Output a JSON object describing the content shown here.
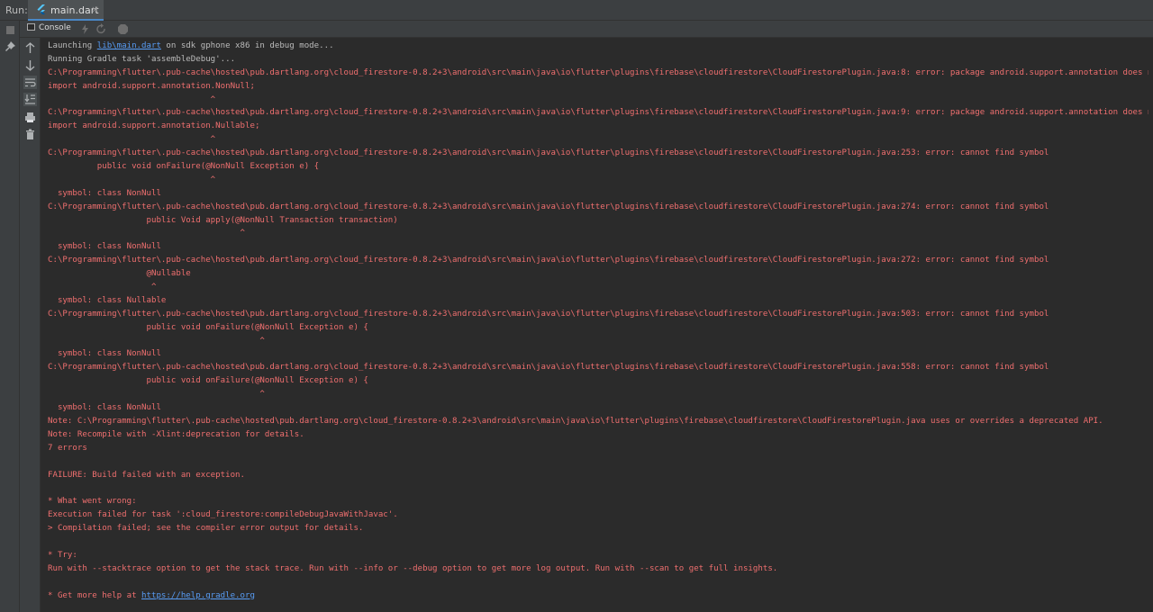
{
  "run_bar": {
    "label": "Run:",
    "tab_name": "main.dart",
    "tab_close": "×"
  },
  "toolbar": {
    "console_label": "Console"
  },
  "console": {
    "launch_prefix": "Launching ",
    "launch_link": "lib\\main.dart",
    "launch_suffix": " on sdk gphone x86 in debug mode...",
    "running_gradle": "Running Gradle task 'assembleDebug'...",
    "lines": [
      "C:\\Programming\\flutter\\.pub-cache\\hosted\\pub.dartlang.org\\cloud_firestore-0.8.2+3\\android\\src\\main\\java\\io\\flutter\\plugins\\firebase\\cloudfirestore\\CloudFirestorePlugin.java:8: error: package android.support.annotation does not exist",
      "import android.support.annotation.NonNull;",
      "                                 ^",
      "C:\\Programming\\flutter\\.pub-cache\\hosted\\pub.dartlang.org\\cloud_firestore-0.8.2+3\\android\\src\\main\\java\\io\\flutter\\plugins\\firebase\\cloudfirestore\\CloudFirestorePlugin.java:9: error: package android.support.annotation does not exist",
      "import android.support.annotation.Nullable;",
      "                                 ^",
      "C:\\Programming\\flutter\\.pub-cache\\hosted\\pub.dartlang.org\\cloud_firestore-0.8.2+3\\android\\src\\main\\java\\io\\flutter\\plugins\\firebase\\cloudfirestore\\CloudFirestorePlugin.java:253: error: cannot find symbol",
      "          public void onFailure(@NonNull Exception e) {",
      "                                 ^",
      "  symbol: class NonNull",
      "C:\\Programming\\flutter\\.pub-cache\\hosted\\pub.dartlang.org\\cloud_firestore-0.8.2+3\\android\\src\\main\\java\\io\\flutter\\plugins\\firebase\\cloudfirestore\\CloudFirestorePlugin.java:274: error: cannot find symbol",
      "                    public Void apply(@NonNull Transaction transaction)",
      "                                       ^",
      "  symbol: class NonNull",
      "C:\\Programming\\flutter\\.pub-cache\\hosted\\pub.dartlang.org\\cloud_firestore-0.8.2+3\\android\\src\\main\\java\\io\\flutter\\plugins\\firebase\\cloudfirestore\\CloudFirestorePlugin.java:272: error: cannot find symbol",
      "                    @Nullable",
      "                     ^",
      "  symbol: class Nullable",
      "C:\\Programming\\flutter\\.pub-cache\\hosted\\pub.dartlang.org\\cloud_firestore-0.8.2+3\\android\\src\\main\\java\\io\\flutter\\plugins\\firebase\\cloudfirestore\\CloudFirestorePlugin.java:503: error: cannot find symbol",
      "                    public void onFailure(@NonNull Exception e) {",
      "                                           ^",
      "  symbol: class NonNull",
      "C:\\Programming\\flutter\\.pub-cache\\hosted\\pub.dartlang.org\\cloud_firestore-0.8.2+3\\android\\src\\main\\java\\io\\flutter\\plugins\\firebase\\cloudfirestore\\CloudFirestorePlugin.java:558: error: cannot find symbol",
      "                    public void onFailure(@NonNull Exception e) {",
      "                                           ^",
      "  symbol: class NonNull",
      "Note: C:\\Programming\\flutter\\.pub-cache\\hosted\\pub.dartlang.org\\cloud_firestore-0.8.2+3\\android\\src\\main\\java\\io\\flutter\\plugins\\firebase\\cloudfirestore\\CloudFirestorePlugin.java uses or overrides a deprecated API.",
      "Note: Recompile with -Xlint:deprecation for details.",
      "7 errors",
      "",
      "FAILURE: Build failed with an exception.",
      "",
      "* What went wrong:",
      "Execution failed for task ':cloud_firestore:compileDebugJavaWithJavac'.",
      "> Compilation failed; see the compiler error output for details.",
      "",
      "* Try:",
      "Run with --stacktrace option to get the stack trace. Run with --info or --debug option to get more log output. Run with --scan to get full insights.",
      ""
    ],
    "help_prefix": "* Get more help at ",
    "help_link": "https://help.gradle.org"
  }
}
